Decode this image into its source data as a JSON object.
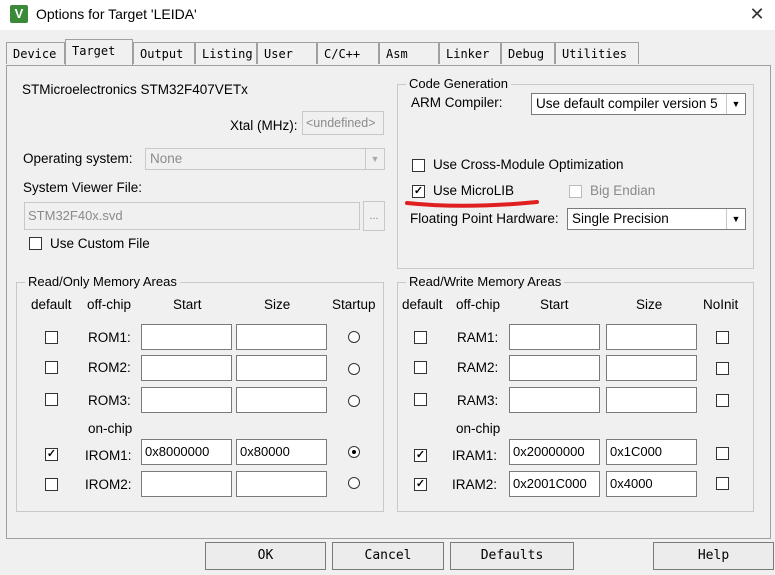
{
  "window": {
    "title": "Options for Target 'LEIDA'",
    "app_icon": "keil-icon",
    "close": "✕"
  },
  "tabs": [
    {
      "label": "Device"
    },
    {
      "label": "Target"
    },
    {
      "label": "Output"
    },
    {
      "label": "Listing"
    },
    {
      "label": "User"
    },
    {
      "label": "C/C++"
    },
    {
      "label": "Asm"
    },
    {
      "label": "Linker"
    },
    {
      "label": "Debug"
    },
    {
      "label": "Utilities"
    }
  ],
  "active_tab": "Target",
  "target": {
    "device": "STMicroelectronics STM32F407VETx",
    "xtal_label": "Xtal (MHz):",
    "xtal_value": "<undefined>",
    "os_label": "Operating system:",
    "os_value": "None",
    "svd_label": "System Viewer File:",
    "svd_value": "STM32F40x.svd",
    "svd_browse": "...",
    "custom_file_label": "Use Custom File"
  },
  "code_gen": {
    "title": "Code Generation",
    "arm_compiler_label": "ARM Compiler:",
    "arm_compiler_value": "Use default compiler version 5",
    "cross_module_label": "Use Cross-Module Optimization",
    "microlib_label": "Use MicroLIB",
    "microlib_checked": true,
    "big_endian_label": "Big Endian",
    "fpu_label": "Floating Point Hardware:",
    "fpu_value": "Single Precision"
  },
  "rom": {
    "title": "Read/Only Memory Areas",
    "headers": {
      "default": "default",
      "offchip": "off-chip",
      "start": "Start",
      "size": "Size",
      "startup": "Startup"
    },
    "onchip_label": "on-chip",
    "rows": [
      {
        "name": "ROM1:",
        "start": "",
        "size": ""
      },
      {
        "name": "ROM2:",
        "start": "",
        "size": ""
      },
      {
        "name": "ROM3:",
        "start": "",
        "size": ""
      },
      {
        "name": "IROM1:",
        "start": "0x8000000",
        "size": "0x80000"
      },
      {
        "name": "IROM2:",
        "start": "",
        "size": ""
      }
    ]
  },
  "ram": {
    "title": "Read/Write Memory Areas",
    "headers": {
      "default": "default",
      "offchip": "off-chip",
      "start": "Start",
      "size": "Size",
      "noinit": "NoInit"
    },
    "onchip_label": "on-chip",
    "rows": [
      {
        "name": "RAM1:",
        "start": "",
        "size": ""
      },
      {
        "name": "RAM2:",
        "start": "",
        "size": ""
      },
      {
        "name": "RAM3:",
        "start": "",
        "size": ""
      },
      {
        "name": "IRAM1:",
        "start": "0x20000000",
        "size": "0x1C000"
      },
      {
        "name": "IRAM2:",
        "start": "0x2001C000",
        "size": "0x4000"
      }
    ]
  },
  "buttons": {
    "ok": "OK",
    "cancel": "Cancel",
    "defaults": "Defaults",
    "help": "Help"
  },
  "colors": {
    "annotation_red": "#e02020",
    "app_icon_green": "#3a8a3a"
  }
}
